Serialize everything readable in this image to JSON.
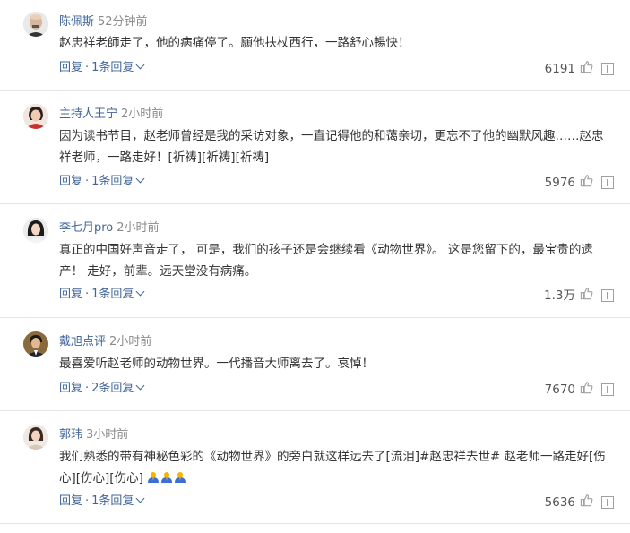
{
  "comments": [
    {
      "author": "陈佩斯",
      "time": "52分钟前",
      "text": "赵忠祥老師走了，他的病痛停了。願他扶杖西行，一路舒心暢快！",
      "reply_label": "回复",
      "replies_label": "1条回复",
      "likes": "6191",
      "avatar": "bald-man-avatar"
    },
    {
      "author": "主持人王宁",
      "time": "2小时前",
      "text": "因为读书节目，赵老师曾经是我的采访对象，一直记得他的和蔼亲切，更忘不了他的幽默风趣……赵忠祥老师，一路走好！[祈祷][祈祷][祈祷]",
      "reply_label": "回复",
      "replies_label": "1条回复",
      "likes": "5976",
      "avatar": "woman-red-top-avatar"
    },
    {
      "author": "李七月pro",
      "time": "2小时前",
      "text": "真正的中国好声音走了， 可是，我们的孩子还是会继续看《动物世界》。 这是您留下的，最宝贵的遗产！ 走好，前辈。远天堂没有病痛。",
      "reply_label": "回复",
      "replies_label": "1条回复",
      "likes": "1.3万",
      "avatar": "woman-dark-hair-avatar"
    },
    {
      "author": "戴旭点评",
      "time": "2小时前",
      "text": "最喜爱听赵老师的动物世界。一代播音大师离去了。哀悼！",
      "reply_label": "回复",
      "replies_label": "2条回复",
      "likes": "7670",
      "avatar": "man-suit-avatar"
    },
    {
      "author": "郭玮",
      "time": "3小时前",
      "text": "我们熟悉的带有神秘色彩的《动物世界》的旁白就这样远去了[流泪]#赵忠祥去世# 赵老师一路走好[伤心][伤心][伤心]",
      "emoji_icons": [
        "praying-emoji",
        "praying-emoji",
        "praying-emoji"
      ],
      "reply_label": "回复",
      "replies_label": "1条回复",
      "likes": "5636",
      "avatar": "woman-light-top-avatar"
    }
  ],
  "colors": {
    "author": "#406599",
    "meta": "#8a8a8a",
    "text": "#333333",
    "divider": "#e6e6e6",
    "icon": "#a0a0a0"
  }
}
